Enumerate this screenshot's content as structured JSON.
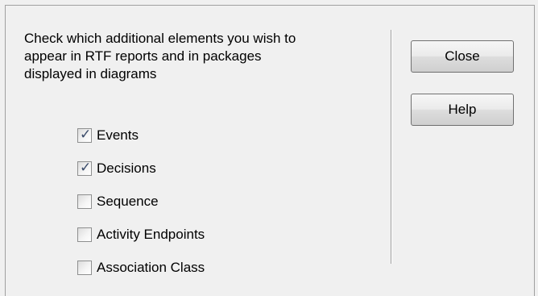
{
  "instruction": "Check which additional elements you wish to\nappear in RTF reports and in packages\ndisplayed in diagrams",
  "options": [
    {
      "label": "Events",
      "checked": true
    },
    {
      "label": "Decisions",
      "checked": true
    },
    {
      "label": "Sequence",
      "checked": false
    },
    {
      "label": "Activity Endpoints",
      "checked": false
    },
    {
      "label": "Association Class",
      "checked": false
    }
  ],
  "buttons": {
    "close_label": "Close",
    "help_label": "Help"
  },
  "colors": {
    "background": "#f0f0f0",
    "check_mark": "#3a4b6a",
    "button_border": "#707070"
  }
}
